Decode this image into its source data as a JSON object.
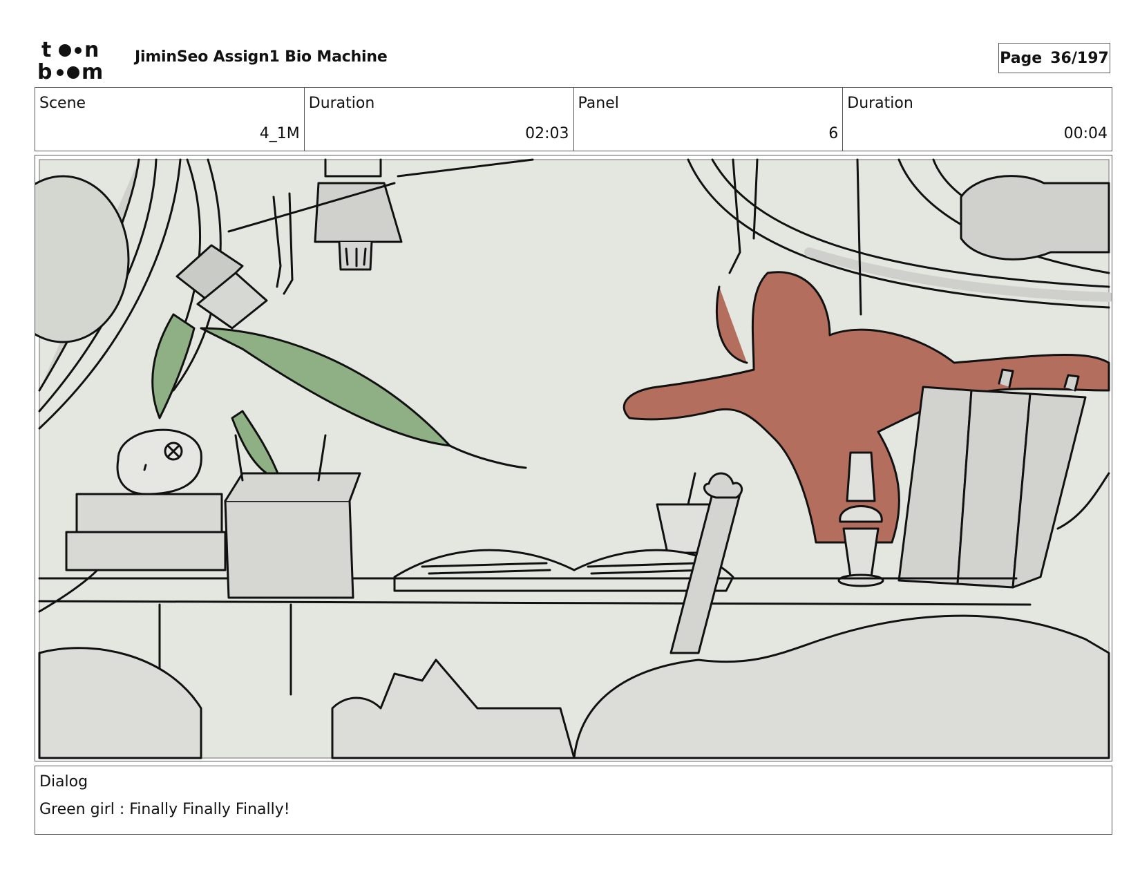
{
  "header": {
    "logo_text": "toon boom",
    "title": "JiminSeo Assign1 Bio Machine",
    "page_label": "Page",
    "page_value": "36/197"
  },
  "info": {
    "scene_label": "Scene",
    "scene_value": "4_1M",
    "scene_duration_label": "Duration",
    "scene_duration_value": "02:03",
    "panel_label": "Panel",
    "panel_value": "6",
    "panel_duration_label": "Duration",
    "panel_duration_value": "00:04"
  },
  "dialog": {
    "label": "Dialog",
    "text": "Green girl : Finally Finally Finally!"
  },
  "colors": {
    "background_wash": "#e4e6e0",
    "green_plant": "#8fb084",
    "red_figure": "#b46e5e",
    "grey_tone": "#d0d0cc",
    "ink": "#111111"
  }
}
